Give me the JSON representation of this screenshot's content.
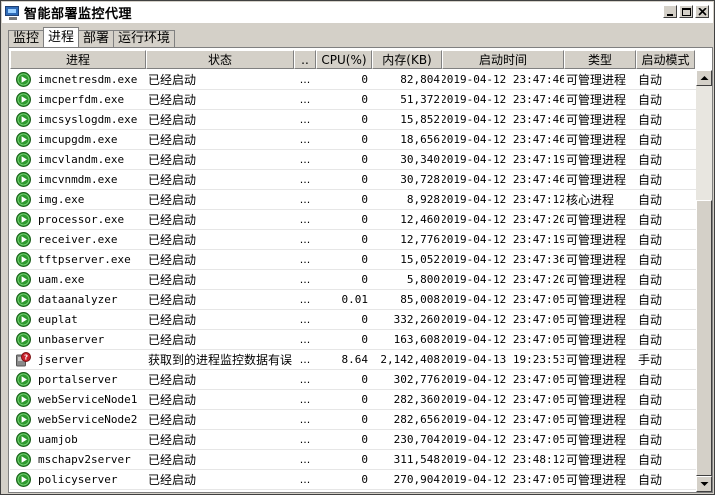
{
  "window": {
    "title": "智能部署监控代理",
    "tabs": [
      {
        "label": "监控",
        "active": false
      },
      {
        "label": "进程",
        "active": true
      },
      {
        "label": "部署",
        "active": false
      },
      {
        "label": "运行环境",
        "active": false
      }
    ]
  },
  "table": {
    "headers": {
      "name": "进程",
      "status": "状态",
      "dots": "..",
      "cpu": "CPU(%)",
      "mem": "内存(KB)",
      "time": "启动时间",
      "type": "类型",
      "mode": "启动模式"
    },
    "rows": [
      {
        "icon": "running",
        "name": "imcnetresdm.exe",
        "status": "已经启动",
        "dots": "...",
        "cpu": "0",
        "mem": "82,804",
        "time": "2019-04-12 23:47:46",
        "type": "可管理进程",
        "mode": "自动"
      },
      {
        "icon": "running",
        "name": "imcperfdm.exe",
        "status": "已经启动",
        "dots": "...",
        "cpu": "0",
        "mem": "51,372",
        "time": "2019-04-12 23:47:46",
        "type": "可管理进程",
        "mode": "自动"
      },
      {
        "icon": "running",
        "name": "imcsyslogdm.exe",
        "status": "已经启动",
        "dots": "...",
        "cpu": "0",
        "mem": "15,852",
        "time": "2019-04-12 23:47:46",
        "type": "可管理进程",
        "mode": "自动"
      },
      {
        "icon": "running",
        "name": "imcupgdm.exe",
        "status": "已经启动",
        "dots": "...",
        "cpu": "0",
        "mem": "18,656",
        "time": "2019-04-12 23:47:46",
        "type": "可管理进程",
        "mode": "自动"
      },
      {
        "icon": "running",
        "name": "imcvlandm.exe",
        "status": "已经启动",
        "dots": "...",
        "cpu": "0",
        "mem": "30,340",
        "time": "2019-04-12 23:47:19",
        "type": "可管理进程",
        "mode": "自动"
      },
      {
        "icon": "running",
        "name": "imcvnmdm.exe",
        "status": "已经启动",
        "dots": "...",
        "cpu": "0",
        "mem": "30,728",
        "time": "2019-04-12 23:47:46",
        "type": "可管理进程",
        "mode": "自动"
      },
      {
        "icon": "running",
        "name": "img.exe",
        "status": "已经启动",
        "dots": "...",
        "cpu": "0",
        "mem": "8,928",
        "time": "2019-04-12 23:47:12",
        "type": "核心进程",
        "mode": "自动"
      },
      {
        "icon": "running",
        "name": "processor.exe",
        "status": "已经启动",
        "dots": "...",
        "cpu": "0",
        "mem": "12,460",
        "time": "2019-04-12 23:47:20",
        "type": "可管理进程",
        "mode": "自动"
      },
      {
        "icon": "running",
        "name": "receiver.exe",
        "status": "已经启动",
        "dots": "...",
        "cpu": "0",
        "mem": "12,776",
        "time": "2019-04-12 23:47:19",
        "type": "可管理进程",
        "mode": "自动"
      },
      {
        "icon": "running",
        "name": "tftpserver.exe",
        "status": "已经启动",
        "dots": "...",
        "cpu": "0",
        "mem": "15,052",
        "time": "2019-04-12 23:47:36",
        "type": "可管理进程",
        "mode": "自动"
      },
      {
        "icon": "running",
        "name": "uam.exe",
        "status": "已经启动",
        "dots": "...",
        "cpu": "0",
        "mem": "5,800",
        "time": "2019-04-12 23:47:20",
        "type": "可管理进程",
        "mode": "自动"
      },
      {
        "icon": "running",
        "name": "dataanalyzer",
        "status": "已经启动",
        "dots": "...",
        "cpu": "0.01",
        "mem": "85,008",
        "time": "2019-04-12 23:47:05",
        "type": "可管理进程",
        "mode": "自动"
      },
      {
        "icon": "running",
        "name": "euplat",
        "status": "已经启动",
        "dots": "...",
        "cpu": "0",
        "mem": "332,260",
        "time": "2019-04-12 23:47:05",
        "type": "可管理进程",
        "mode": "自动"
      },
      {
        "icon": "running",
        "name": "unbaserver",
        "status": "已经启动",
        "dots": "...",
        "cpu": "0",
        "mem": "163,608",
        "time": "2019-04-12 23:47:05",
        "type": "可管理进程",
        "mode": "自动"
      },
      {
        "icon": "error",
        "name": "jserver",
        "status": "获取到的进程监控数据有误",
        "dots": "...",
        "cpu": "8.64",
        "mem": "2,142,408",
        "time": "2019-04-13 19:23:53",
        "type": "可管理进程",
        "mode": "手动"
      },
      {
        "icon": "running",
        "name": "portalserver",
        "status": "已经启动",
        "dots": "...",
        "cpu": "0",
        "mem": "302,776",
        "time": "2019-04-12 23:47:05",
        "type": "可管理进程",
        "mode": "自动"
      },
      {
        "icon": "running",
        "name": "webServiceNode1",
        "status": "已经启动",
        "dots": "...",
        "cpu": "0",
        "mem": "282,360",
        "time": "2019-04-12 23:47:05",
        "type": "可管理进程",
        "mode": "自动"
      },
      {
        "icon": "running",
        "name": "webServiceNode2",
        "status": "已经启动",
        "dots": "...",
        "cpu": "0",
        "mem": "282,656",
        "time": "2019-04-12 23:47:05",
        "type": "可管理进程",
        "mode": "自动"
      },
      {
        "icon": "running",
        "name": "uamjob",
        "status": "已经启动",
        "dots": "...",
        "cpu": "0",
        "mem": "230,704",
        "time": "2019-04-12 23:47:05",
        "type": "可管理进程",
        "mode": "自动"
      },
      {
        "icon": "running",
        "name": "mschapv2server",
        "status": "已经启动",
        "dots": "...",
        "cpu": "0",
        "mem": "311,548",
        "time": "2019-04-12 23:48:12",
        "type": "可管理进程",
        "mode": "自动"
      },
      {
        "icon": "running",
        "name": "policyserver",
        "status": "已经启动",
        "dots": "...",
        "cpu": "0",
        "mem": "270,904",
        "time": "2019-04-12 23:47:05",
        "type": "可管理进程",
        "mode": "自动"
      }
    ]
  },
  "colors": {
    "running": "#2e9a2e",
    "error": "#c8202a"
  }
}
